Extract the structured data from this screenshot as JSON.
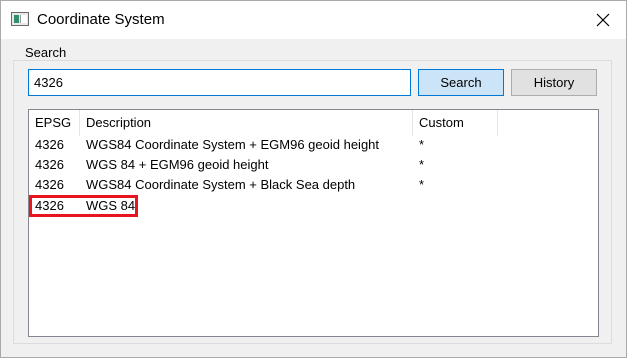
{
  "window": {
    "title": "Coordinate System"
  },
  "search": {
    "group_label": "Search",
    "value": "4326",
    "search_button": "Search",
    "history_button": "History"
  },
  "results": {
    "columns": [
      "EPSG",
      "Description",
      "Custom"
    ],
    "rows": [
      {
        "epsg": "4326",
        "description": "WGS84 Coordinate System + EGM96 geoid height",
        "custom": "*"
      },
      {
        "epsg": "4326",
        "description": "WGS 84 + EGM96 geoid height",
        "custom": "*"
      },
      {
        "epsg": "4326",
        "description": "WGS84 Coordinate System + Black Sea depth",
        "custom": "*"
      },
      {
        "epsg": "4326",
        "description": "WGS 84",
        "custom": ""
      }
    ],
    "highlighted_row": 3
  },
  "icons": {
    "app": "window-icon",
    "close": "close-icon"
  },
  "colors": {
    "accent": "#0078d7",
    "search_button_bg": "#cce4f7",
    "highlight_border": "#e8141f"
  }
}
